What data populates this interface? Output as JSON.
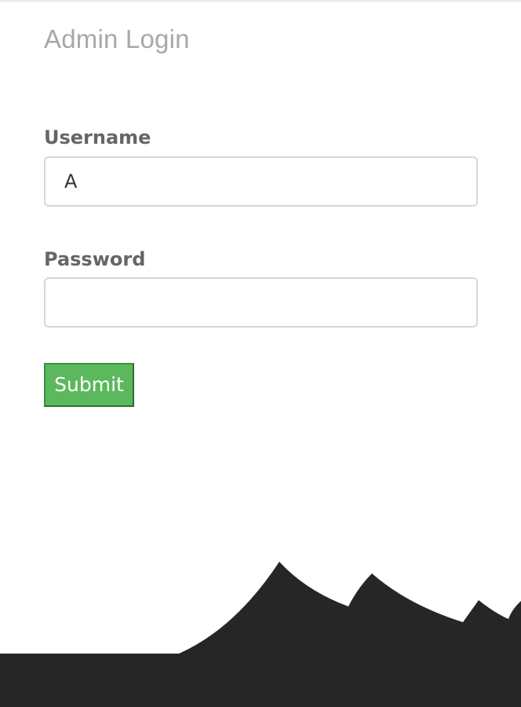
{
  "page": {
    "title": "Admin Login"
  },
  "form": {
    "username": {
      "label": "Username",
      "value": "A"
    },
    "password": {
      "label": "Password",
      "value": ""
    },
    "submit_label": "Submit"
  },
  "colors": {
    "submit_background": "#5cb85c",
    "mountains": "#262626",
    "title_text": "#a8a8a8",
    "label_text": "#666666"
  }
}
